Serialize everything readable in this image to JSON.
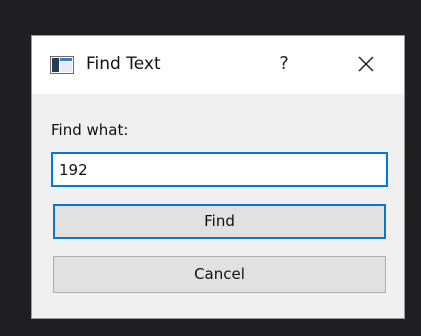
{
  "window": {
    "title": "Find Text",
    "help_label": "?",
    "close_icon": "close-icon",
    "app_icon": "window-icon"
  },
  "form": {
    "find_label": "Find what:",
    "find_value": "192"
  },
  "buttons": {
    "find_label": "Find",
    "cancel_label": "Cancel"
  },
  "colors": {
    "focus_accent": "#0078d7",
    "dialog_bg": "#f0f0f0",
    "titlebar_bg": "#ffffff",
    "desktop_bg": "#1f1f22"
  }
}
